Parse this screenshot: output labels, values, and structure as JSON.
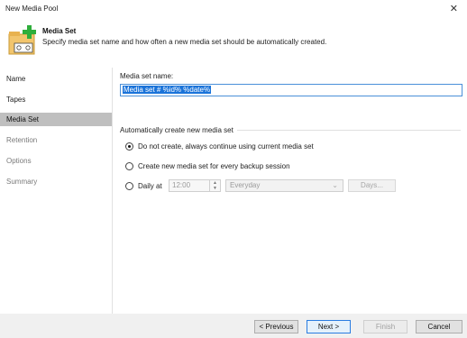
{
  "window": {
    "title": "New Media Pool"
  },
  "header": {
    "title": "Media Set",
    "subtitle": "Specify media set name and how often a new media set should be automatically created."
  },
  "nav": {
    "items": [
      {
        "label": "Name",
        "state": "normal"
      },
      {
        "label": "Tapes",
        "state": "normal"
      },
      {
        "label": "Media Set",
        "state": "active"
      },
      {
        "label": "Retention",
        "state": "disabled"
      },
      {
        "label": "Options",
        "state": "disabled"
      },
      {
        "label": "Summary",
        "state": "disabled"
      }
    ]
  },
  "form": {
    "name_label": "Media set name:",
    "name_value": "Media set # %id% %date%",
    "group_title": "Automatically create new media set",
    "options": [
      {
        "label": "Do not create, always continue using current media set",
        "checked": true
      },
      {
        "label": "Create new media set for every backup session",
        "checked": false
      },
      {
        "label": "Daily at",
        "checked": false
      }
    ],
    "time_value": "12:00",
    "schedule_value": "Everyday",
    "days_button": "Days..."
  },
  "footer": {
    "previous": "< Previous",
    "next": "Next >",
    "finish": "Finish",
    "cancel": "Cancel"
  },
  "colors": {
    "accent": "#2a7de1",
    "nav_active": "#bfbfbf",
    "selection": "#1a73d9"
  }
}
